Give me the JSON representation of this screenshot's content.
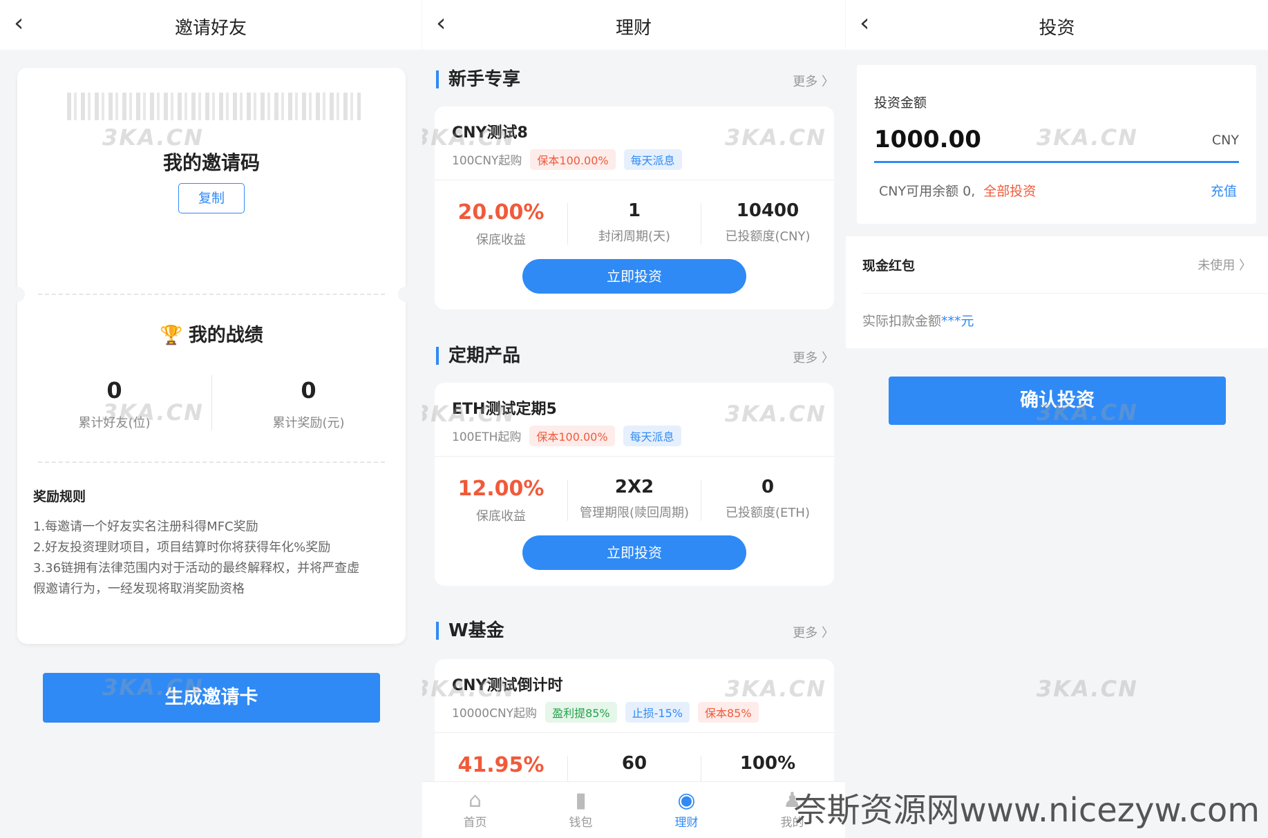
{
  "invite": {
    "title": "邀请好友",
    "code_title": "我的邀请码",
    "copy_label": "复制",
    "perf_title": "我的战绩",
    "stats": [
      {
        "value": "0",
        "label": "累计好友(位)"
      },
      {
        "value": "0",
        "label": "累计奖励(元)"
      }
    ],
    "rules_title": "奖励规则",
    "rules": [
      "1.每邀请一个好友实名注册科得MFC奖励",
      "2.好友投资理财项目，项目结算时你将获得年化%奖励",
      "3.36链拥有法律范围内对于活动的最终解释权，并将严查虚",
      "假邀请行为，一经发现将取消奖励资格"
    ],
    "generate_label": "生成邀请卡"
  },
  "finance": {
    "title": "理财",
    "more_label": "更多 〉",
    "sections": [
      {
        "title": "新手专享",
        "product": {
          "name": "CNY测试8",
          "min": "100CNY起购",
          "tags": [
            {
              "text": "保本100.00%",
              "color": "red"
            },
            {
              "text": "每天派息",
              "color": "blue"
            }
          ],
          "stats": [
            {
              "value": "20.00%",
              "label": "保底收益"
            },
            {
              "value": "1",
              "label": "封闭周期(天)"
            },
            {
              "value": "10400",
              "label": "已投额度(CNY)"
            }
          ],
          "button": "立即投资"
        }
      },
      {
        "title": "定期产品",
        "product": {
          "name": "ETH测试定期5",
          "min": "100ETH起购",
          "tags": [
            {
              "text": "保本100.00%",
              "color": "red"
            },
            {
              "text": "每天派息",
              "color": "blue"
            }
          ],
          "stats": [
            {
              "value": "12.00%",
              "label": "保底收益"
            },
            {
              "value": "2X2",
              "label": "管理期限(赎回周期)"
            },
            {
              "value": "0",
              "label": "已投额度(ETH)"
            }
          ],
          "button": "立即投资"
        }
      },
      {
        "title": "W基金",
        "product": {
          "name": "CNY测试倒计时",
          "min": "10000CNY起购",
          "tags": [
            {
              "text": "盈利提85%",
              "color": "green"
            },
            {
              "text": "止损-15%",
              "color": "blue"
            },
            {
              "text": "保本85%",
              "color": "red"
            }
          ],
          "stats": [
            {
              "value": "41.95%",
              "label": ""
            },
            {
              "value": "60",
              "label": ""
            },
            {
              "value": "100%",
              "label": ""
            }
          ]
        }
      }
    ],
    "tabs": [
      {
        "label": "首页",
        "icon": "home-icon"
      },
      {
        "label": "钱包",
        "icon": "wallet-icon"
      },
      {
        "label": "理财",
        "icon": "finance-icon"
      },
      {
        "label": "我的",
        "icon": "user-icon"
      }
    ]
  },
  "invest": {
    "title": "投资",
    "amount_label": "投资金额",
    "amount_value": "1000.00",
    "currency": "CNY",
    "balance_text": "CNY可用余额 0,",
    "invest_all": "全部投资",
    "recharge": "充值",
    "red_packet_title": "现金红包",
    "red_packet_status": "未使用 〉",
    "deduct_prefix": "实际扣款金额",
    "deduct_value": "***元",
    "confirm_label": "确认投资"
  },
  "watermark": "3KA.CN",
  "site_mark": "奈斯资源网www.nicezyw.com",
  "colors": {
    "accent": "#2f8af5",
    "highlight": "#f05a3a"
  }
}
